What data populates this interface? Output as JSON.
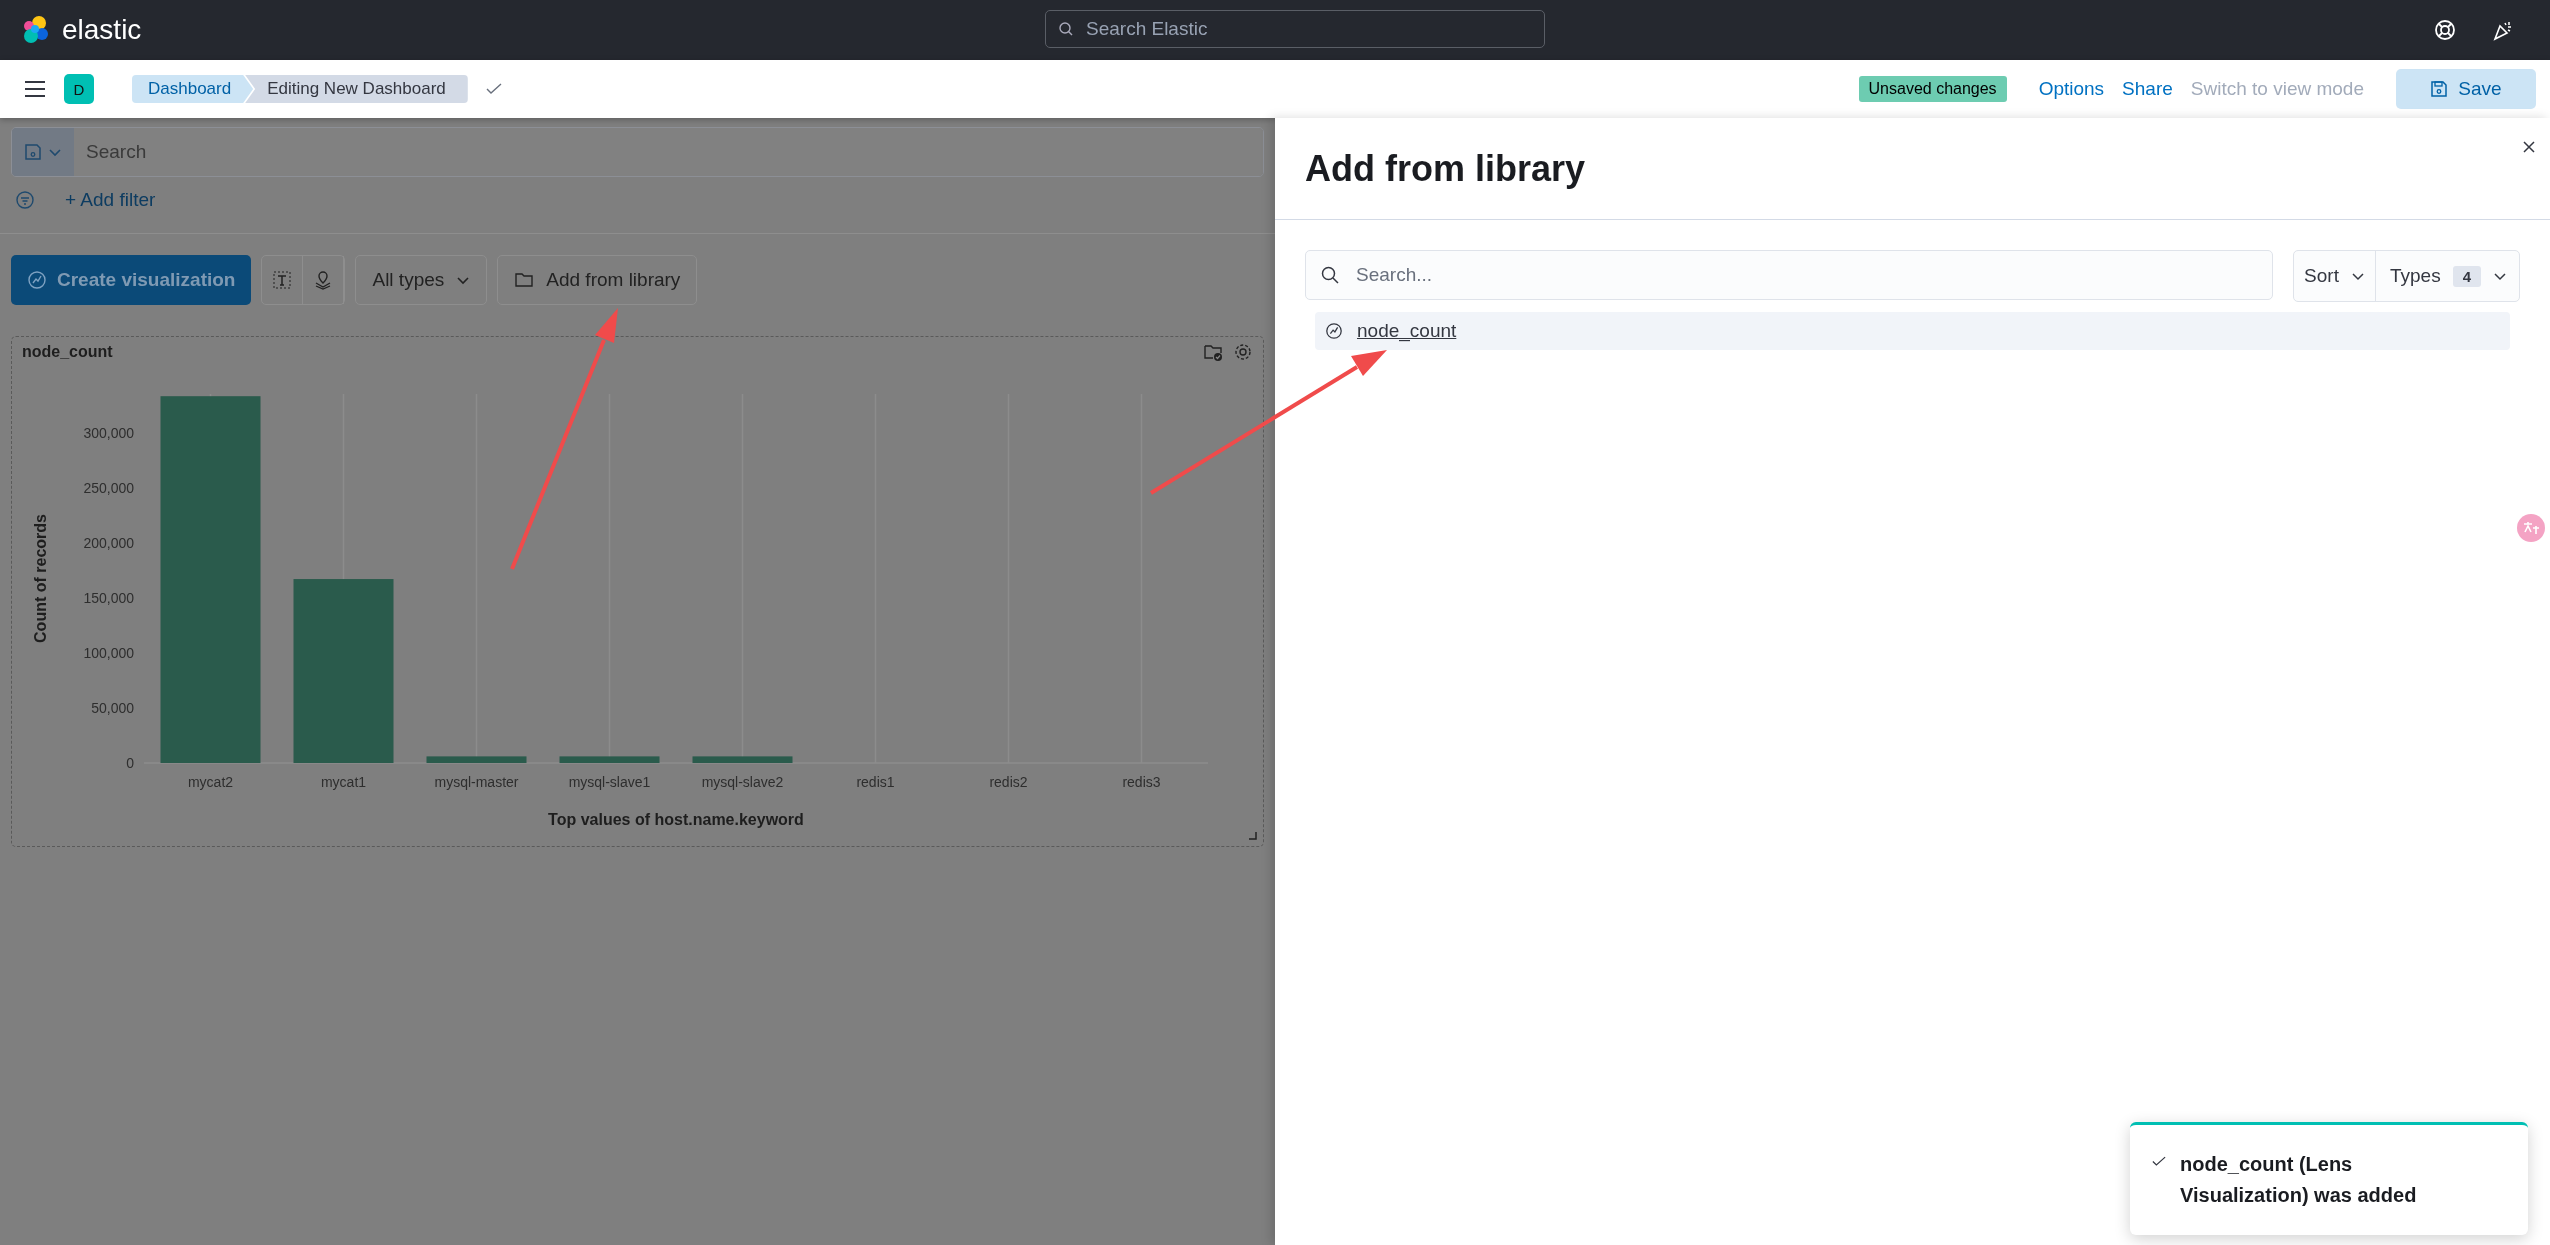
{
  "header": {
    "logo": "elastic",
    "search_placeholder": "Search Elastic"
  },
  "nav": {
    "avatar": "D",
    "breadcrumbs": [
      {
        "label": "Dashboard",
        "kind": "link"
      },
      {
        "label": "Editing New Dashboard",
        "kind": "current"
      }
    ],
    "badge": "Unsaved changes",
    "actions": [
      {
        "label": "Options",
        "disabled": false
      },
      {
        "label": "Share",
        "disabled": false
      },
      {
        "label": "Switch to view mode",
        "disabled": true
      }
    ],
    "save": "Save"
  },
  "query": {
    "placeholder": "Search",
    "add_filter": "+ Add filter"
  },
  "toolbar": {
    "create": "Create visualization",
    "types": "All types",
    "library": "Add from library"
  },
  "panel": {
    "title": "node_count",
    "chart_data": {
      "type": "bar",
      "xlabel": "Top values of host.name.keyword",
      "ylabel": "Count of records",
      "categories": [
        "mycat2",
        "mycat1",
        "mysql-master",
        "mysql-slave1",
        "mysql-slave2",
        "redis1",
        "redis2",
        "redis3"
      ],
      "values": [
        333000,
        167000,
        6000,
        6000,
        6000,
        0,
        0,
        0
      ],
      "ylim": [
        0,
        335000
      ],
      "grid": true,
      "yticks": [
        {
          "value": 0,
          "label": "0"
        },
        {
          "value": 50000,
          "label": "50,000"
        },
        {
          "value": 100000,
          "label": "100,000"
        },
        {
          "value": 150000,
          "label": "150,000"
        },
        {
          "value": 200000,
          "label": "200,000"
        },
        {
          "value": 250000,
          "label": "250,000"
        },
        {
          "value": 300000,
          "label": "300,000"
        }
      ]
    }
  },
  "flyout": {
    "title": "Add from library",
    "search_placeholder": "Search...",
    "sort": "Sort",
    "types": "Types",
    "types_count": "4",
    "items": [
      {
        "label": "node_count"
      }
    ]
  },
  "toast": {
    "message": "node_count (Lens Visualization) was added"
  }
}
